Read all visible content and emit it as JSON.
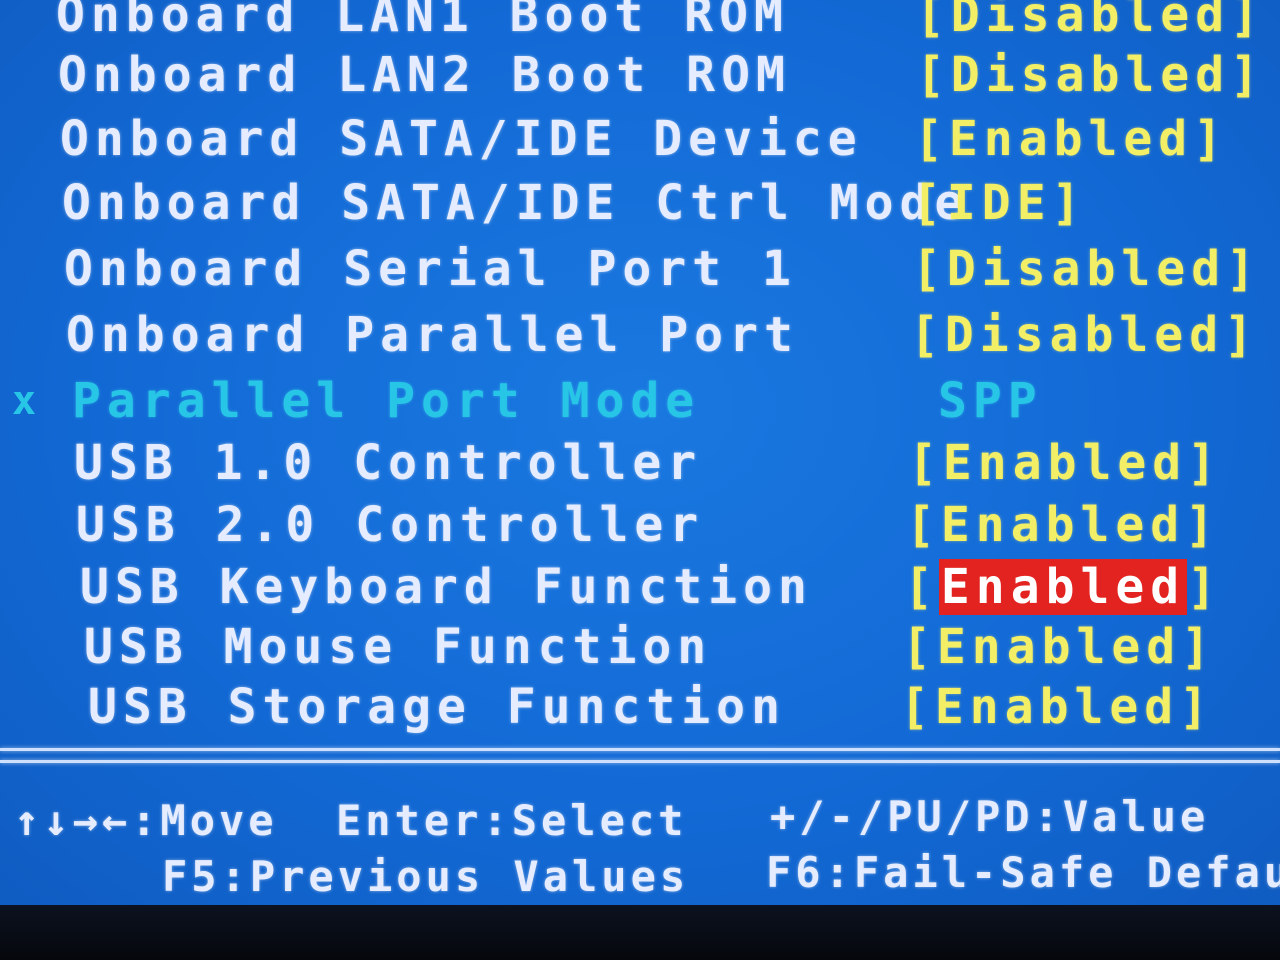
{
  "settings": [
    {
      "label": "Onboard LAN1 Boot ROM",
      "value": "[Disabled]"
    },
    {
      "label": "Onboard LAN2 Boot ROM",
      "value": "[Disabled]"
    },
    {
      "label": "Onboard SATA/IDE Device",
      "value": "[Enabled]"
    },
    {
      "label": "Onboard SATA/IDE Ctrl Mode",
      "value": "[IDE]"
    },
    {
      "label": "Onboard Serial Port 1",
      "value": "[Disabled]"
    },
    {
      "label": "Onboard Parallel Port",
      "value": "[Disabled]"
    },
    {
      "marker": "x",
      "label": "Parallel Port Mode",
      "value": "SPP"
    },
    {
      "label": "USB 1.0 Controller",
      "value": "[Enabled]"
    },
    {
      "label": "USB 2.0 Controller",
      "value": "[Enabled]"
    },
    {
      "label": "USB Keyboard Function",
      "value_open": "[",
      "value_selected": "Enabled",
      "value_close": "]"
    },
    {
      "label": "USB Mouse Function",
      "value": "[Enabled]"
    },
    {
      "label": "USB Storage Function",
      "value": "[Enabled]"
    }
  ],
  "help": {
    "move": "↑↓→←:Move",
    "select": "Enter:Select",
    "value": "+/-/PU/PD:Value",
    "previous": "F5:Previous Values",
    "failsafe": "F6:Fail-Safe Defau"
  },
  "colors": {
    "background": "#136ad6",
    "label": "#e6ecff",
    "value": "#f2ee66",
    "disabled": "#27c6e6",
    "highlight": "#e2231f"
  }
}
